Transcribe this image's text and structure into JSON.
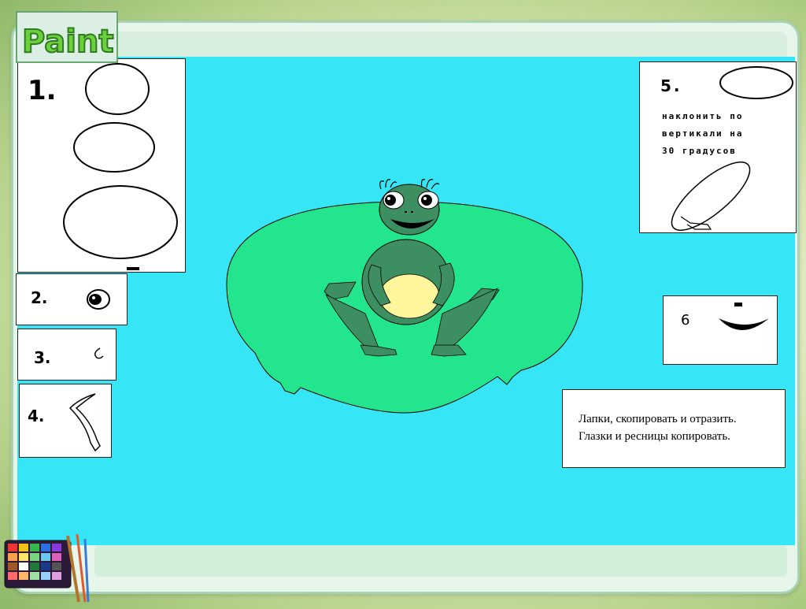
{
  "logo": {
    "text": "Paint"
  },
  "steps": {
    "s1": {
      "label": "1."
    },
    "s2": {
      "label": "2."
    },
    "s3": {
      "label": "3."
    },
    "s4": {
      "label": "4."
    },
    "s5": {
      "label": "5.",
      "hint_lines": [
        "наклонить по",
        "вертикали на",
        "30 градусов"
      ]
    },
    "s6": {
      "label": "6"
    }
  },
  "note": {
    "line1": "Лапки, скопировать и отразить.",
    "line2": "Глазки и ресницы копировать."
  },
  "colors": {
    "canvas": "#36e6f7",
    "lily_pad": "#22e58e",
    "frog_body": "#3d8f62",
    "frog_belly": "#fff59a"
  },
  "icons": [
    "paint-palette-icon",
    "frog-illustration"
  ]
}
